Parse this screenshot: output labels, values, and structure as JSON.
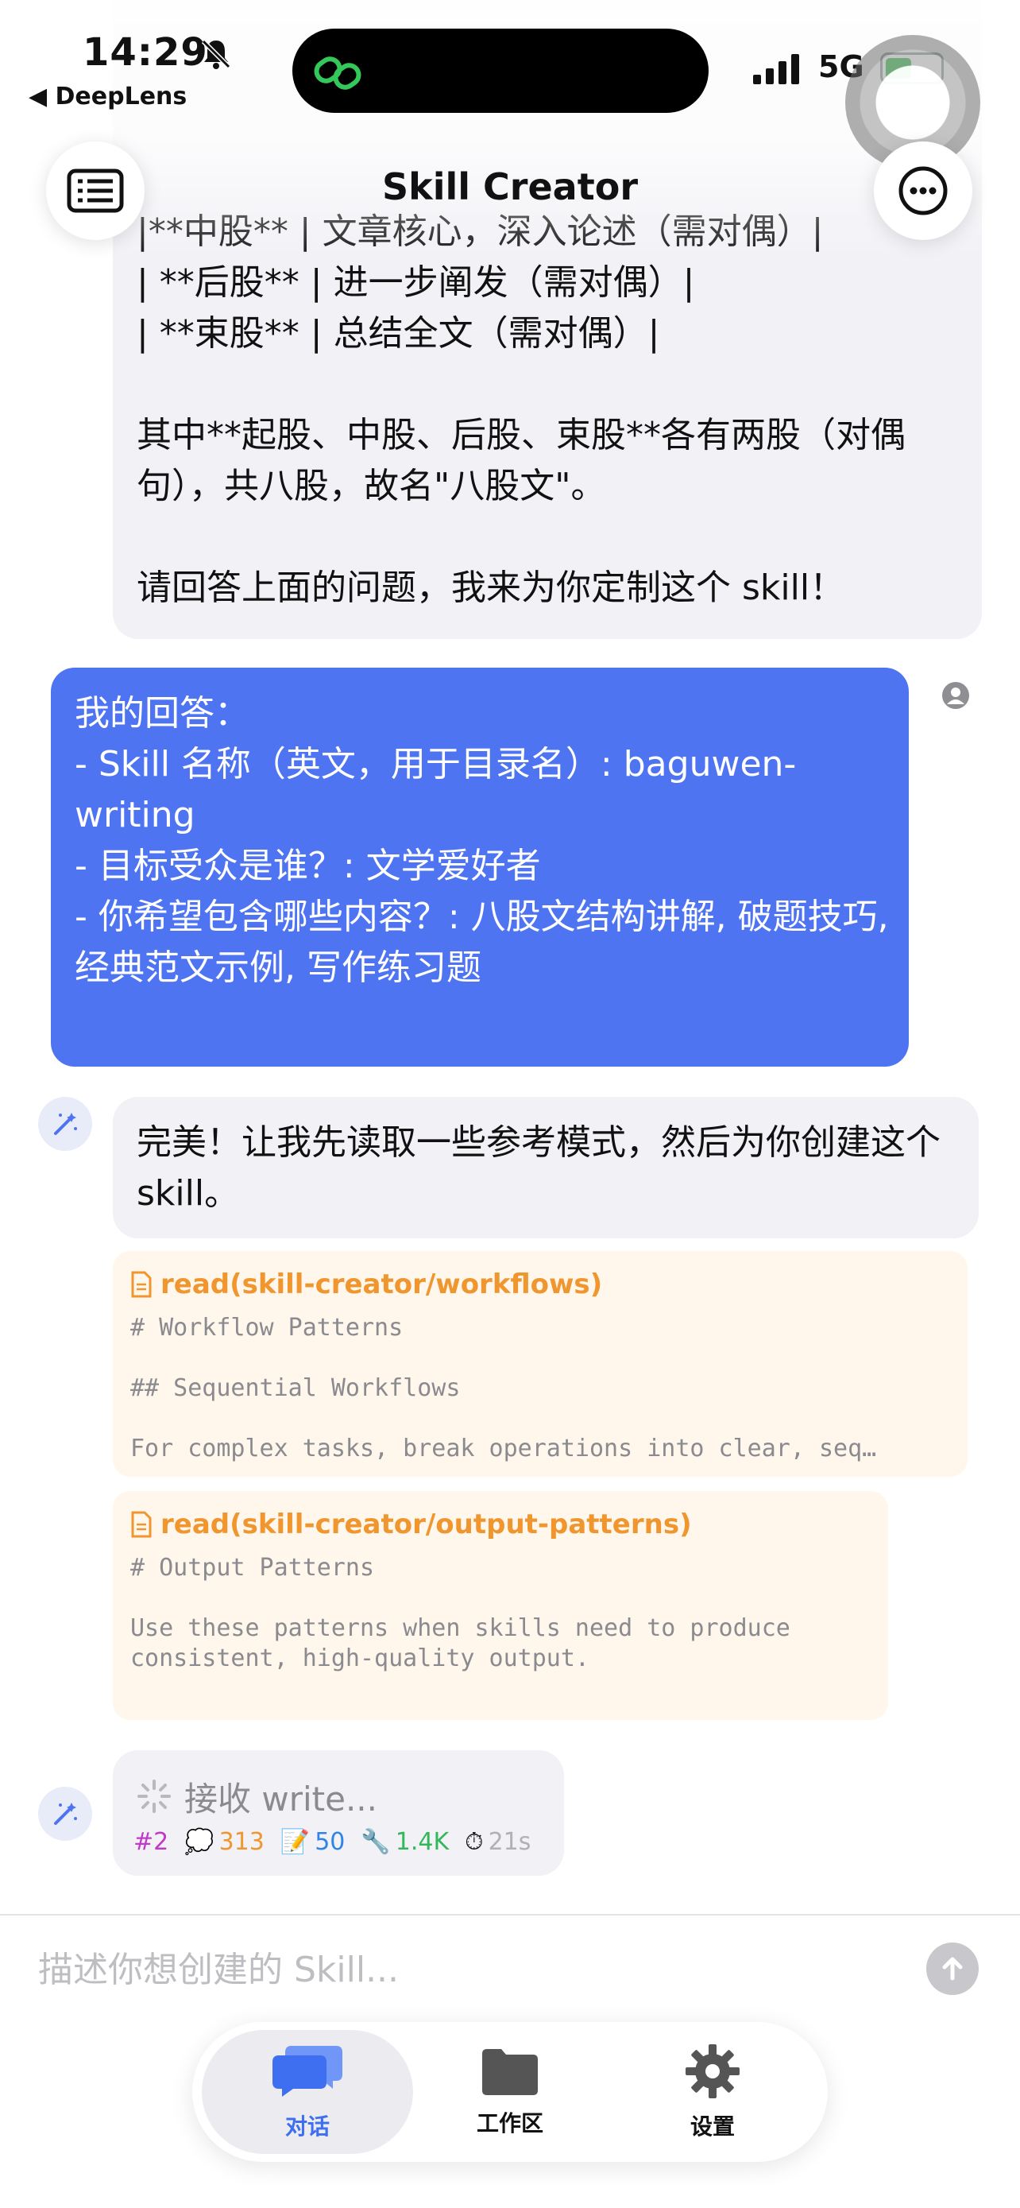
{
  "status_bar": {
    "time": "14:29",
    "back_app": "◀ DeepLens",
    "network": "5G"
  },
  "header": {
    "title": "Skill Creator"
  },
  "messages": {
    "assistant_1": "|**中股** | 文章核心，深入论述（需对偶）|\n| **后股** | 进一步阐发（需对偶）|\n| **束股** | 总结全文（需对偶）|\n\n其中**起股、中股、后股、束股**各有两股（对偶句），共八股，故名\"八股文\"。\n\n请回答上面的问题，我来为你定制这个 skill！",
    "user_1": "我的回答：\n- Skill 名称（英文，用于目录名）: baguwen-writing\n- 目标受众是谁？: 文学爱好者\n- 你希望包含哪些内容？: 八股文结构讲解, 破题技巧, 经典范文示例, 写作练习题",
    "assistant_2": "完美！让我先读取一些参考模式，然后为你创建这个 skill。"
  },
  "tools": [
    {
      "title": "read(skill-creator/workflows)",
      "body": "# Workflow Patterns\n\n## Sequential Workflows\n\nFor complex tasks, break operations into clear, seq…"
    },
    {
      "title": "read(skill-creator/output-patterns)",
      "body": "# Output Patterns\n\nUse these patterns when skills need to produce\nconsistent, high-quality output."
    }
  ],
  "pending": {
    "label": "接收 write...",
    "stats": {
      "index": "#2",
      "thoughts": "313",
      "edits": "50",
      "tools": "1.4K",
      "time": "21s"
    },
    "colors": {
      "index": "#c239c9",
      "thoughts": "#f0962e",
      "edits": "#2f84e8",
      "tools": "#32b75a",
      "time": "#b0b0b5"
    }
  },
  "input": {
    "placeholder": "描述你想创建的 Skill..."
  },
  "tabs": [
    {
      "label": "对话",
      "icon": "chat-bubbles-icon",
      "active": true
    },
    {
      "label": "工作区",
      "icon": "folder-icon",
      "active": false
    },
    {
      "label": "设置",
      "icon": "gear-icon",
      "active": false
    }
  ],
  "accent_color": "#4f74f2"
}
